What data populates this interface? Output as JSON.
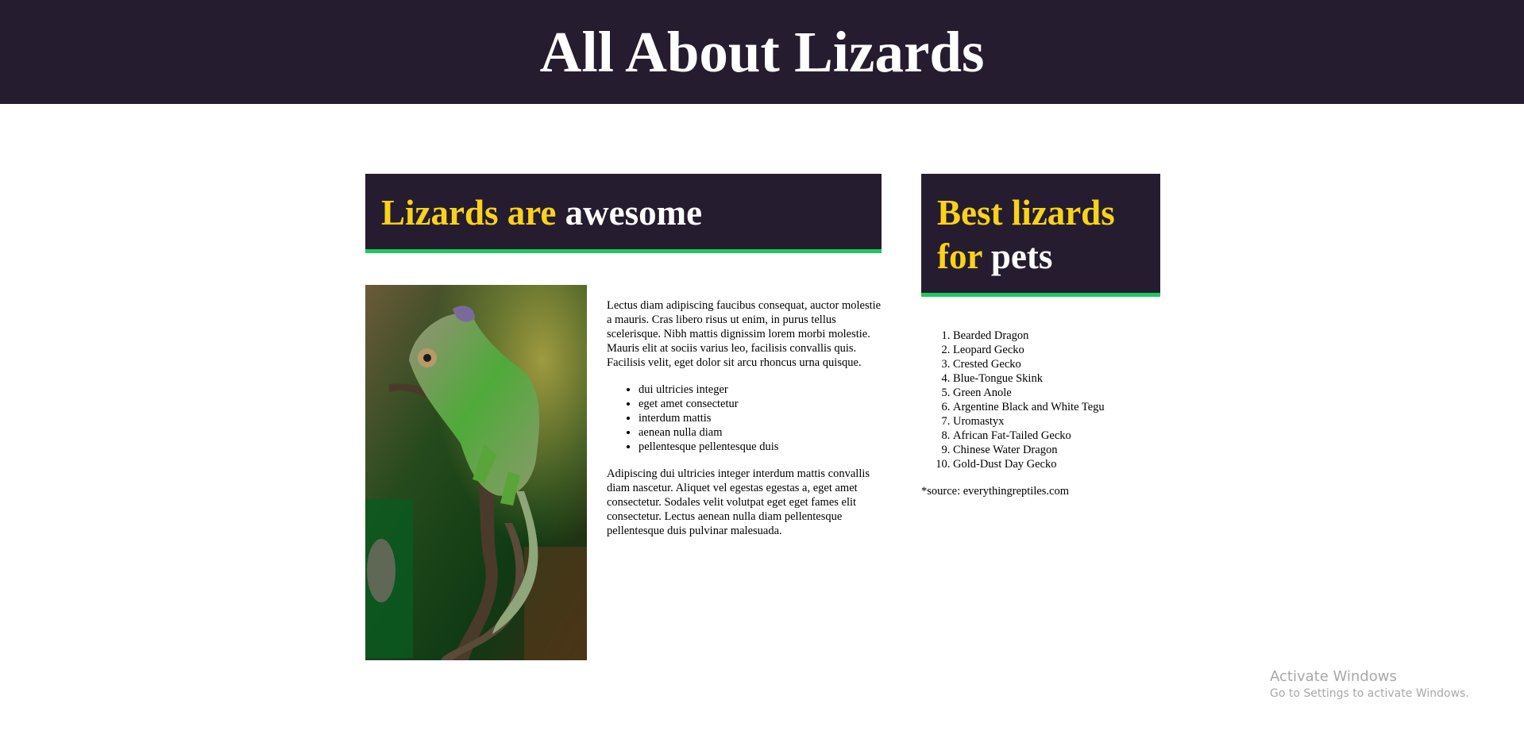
{
  "header": {
    "title": "All About Lizards"
  },
  "main": {
    "heading_accent": "Lizards are",
    "heading_plain": "awesome",
    "image_alt": "Chameleon on a branch",
    "paragraph1": "Lectus diam adipiscing faucibus consequat, auctor molestie a mauris. Cras libero risus ut enim, in purus tellus scelerisque. Nibh mattis dignissim lorem morbi molestie. Mauris elit at sociis varius leo, facilisis convallis quis. Facilisis velit, eget dolor sit arcu rhoncus urna quisque.",
    "bullets": [
      "dui ultricies integer",
      "eget amet consectetur",
      "interdum mattis",
      "aenean nulla diam",
      "pellentesque pellentesque duis"
    ],
    "paragraph2": "Adipiscing dui ultricies integer interdum mattis convallis diam nascetur. Aliquet vel egestas egestas a, eget amet consectetur. Sodales velit volutpat eget eget fames elit consectetur. Lectus aenean nulla diam pellentesque pellentesque duis pulvinar malesuada."
  },
  "sidebar": {
    "heading_accent_line1": "Best lizards",
    "heading_accent_line2": "for",
    "heading_plain": "pets",
    "list": [
      "Bearded Dragon",
      "Leopard Gecko",
      "Crested Gecko",
      "Blue-Tongue Skink",
      "Green Anole",
      "Argentine Black and White Tegu",
      "Uromastyx",
      "African Fat-Tailed Gecko",
      "Chinese Water Dragon",
      "Gold-Dust Day Gecko"
    ],
    "source": "*source: everythingreptiles.com"
  },
  "overlay": {
    "activate_title": "Activate Windows",
    "activate_subtitle": "Go to Settings to activate Windows."
  },
  "colors": {
    "header_bg": "#261c2f",
    "accent_yellow": "#f9d21b",
    "accent_green": "#1ec95f"
  }
}
